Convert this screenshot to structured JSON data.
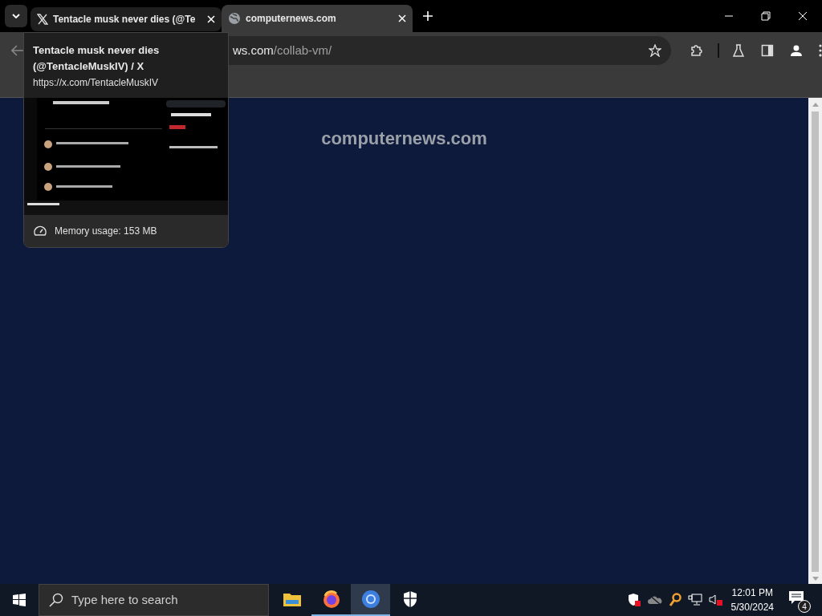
{
  "tabs": [
    {
      "title": "Tentacle musk never dies (@Te",
      "kind": "x",
      "selected": false,
      "hovered": true
    },
    {
      "title": "computernews.com",
      "kind": "globe",
      "selected": true,
      "hovered": false
    }
  ],
  "address_bar": {
    "host_visible": "ws.com",
    "path": "/collab-vm/",
    "bookmarked": false
  },
  "tab_hover_card": {
    "title": "Tentacle musk never dies (@TentacleMuskIV) / X",
    "url": "https://x.com/TentacleMuskIV",
    "memory": "Memory usage: 153 MB"
  },
  "page": {
    "heading": "computernews.com"
  },
  "taskbar": {
    "search_placeholder": "Type here to search",
    "apps": [
      {
        "kind": "folder",
        "running": false,
        "active": false
      },
      {
        "kind": "firefox",
        "running": true,
        "active": false
      },
      {
        "kind": "chrome",
        "running": true,
        "active": true
      },
      {
        "kind": "shield",
        "running": false,
        "active": false
      }
    ],
    "time": "12:01 PM",
    "date": "5/30/2024",
    "notifications": "4"
  }
}
